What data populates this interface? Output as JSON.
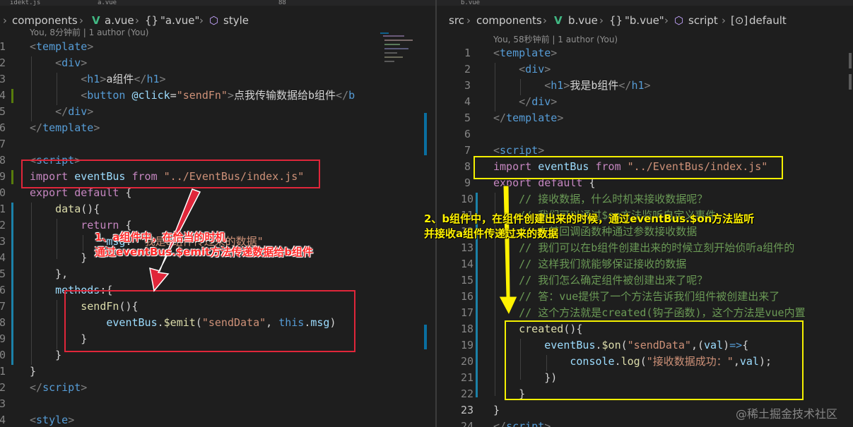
{
  "left": {
    "tab_fragments": [
      "idekt.js",
      "a.vue",
      "88"
    ],
    "breadcrumb": {
      "folder": "components",
      "file": "a.vue",
      "component": "\"a.vue\"",
      "section": "style"
    },
    "blame": "You, 8分钟前 | 1 author (You)",
    "line_numbers": [
      "1",
      "2",
      "3",
      "4",
      "5",
      "6",
      "7",
      "8",
      "9",
      "0",
      "1",
      "2",
      "3",
      "4",
      "5",
      "6",
      "7",
      "8",
      "9",
      "0",
      "1",
      "2",
      "3",
      "4",
      "5"
    ],
    "lines": [
      [
        [
          "punct",
          "<"
        ],
        [
          "tag",
          "template"
        ],
        [
          "punct",
          ">"
        ]
      ],
      [
        [
          "txt",
          "    "
        ],
        [
          "punct",
          "<"
        ],
        [
          "tag",
          "div"
        ],
        [
          "punct",
          ">"
        ]
      ],
      [
        [
          "txt",
          "        "
        ],
        [
          "punct",
          "<"
        ],
        [
          "tag",
          "h1"
        ],
        [
          "punct",
          ">"
        ],
        [
          "txt",
          "a组件"
        ],
        [
          "punct",
          "</"
        ],
        [
          "tag",
          "h1"
        ],
        [
          "punct",
          ">"
        ]
      ],
      [
        [
          "txt",
          "        "
        ],
        [
          "punct",
          "<"
        ],
        [
          "tag",
          "button"
        ],
        [
          "txt",
          " "
        ],
        [
          "attr",
          "@click"
        ],
        [
          "txt",
          "="
        ],
        [
          "str",
          "\"sendFn\""
        ],
        [
          "punct",
          ">"
        ],
        [
          "txt",
          "点我传输数据给b组件"
        ],
        [
          "punct",
          "</"
        ],
        [
          "tag",
          "b"
        ]
      ],
      [
        [
          "txt",
          "    "
        ],
        [
          "punct",
          "</"
        ],
        [
          "tag",
          "div"
        ],
        [
          "punct",
          ">"
        ]
      ],
      [
        [
          "punct",
          "</"
        ],
        [
          "tag",
          "template"
        ],
        [
          "punct",
          ">"
        ]
      ],
      [
        [
          "txt",
          ""
        ]
      ],
      [
        [
          "punct",
          "<"
        ],
        [
          "tag",
          "script"
        ],
        [
          "punct",
          ">"
        ]
      ],
      [
        [
          "kw",
          "import"
        ],
        [
          "txt",
          " "
        ],
        [
          "var",
          "eventBus"
        ],
        [
          "txt",
          " "
        ],
        [
          "kw",
          "from"
        ],
        [
          "txt",
          " "
        ],
        [
          "str",
          "\"../EventBus/index.js\""
        ]
      ],
      [
        [
          "kw",
          "export"
        ],
        [
          "txt",
          " "
        ],
        [
          "kw",
          "default"
        ],
        [
          "txt",
          " {"
        ]
      ],
      [
        [
          "txt",
          "    "
        ],
        [
          "fn",
          "data"
        ],
        [
          "txt",
          "(){"
        ]
      ],
      [
        [
          "txt",
          "        "
        ],
        [
          "kw",
          "return"
        ],
        [
          "txt",
          " {"
        ]
      ],
      [
        [
          "txt",
          "            "
        ],
        [
          "var",
          "msg"
        ],
        [
          "txt",
          ": "
        ],
        [
          "str",
          "\"我是a组件传过来的数据\""
        ]
      ],
      [
        [
          "txt",
          "        }"
        ]
      ],
      [
        [
          "txt",
          "    },"
        ]
      ],
      [
        [
          "txt",
          "    "
        ],
        [
          "var",
          "methods"
        ],
        [
          "txt",
          ":{"
        ]
      ],
      [
        [
          "txt",
          "        "
        ],
        [
          "fn",
          "sendFn"
        ],
        [
          "txt",
          "(){"
        ]
      ],
      [
        [
          "txt",
          "            "
        ],
        [
          "var",
          "eventBus"
        ],
        [
          "txt",
          "."
        ],
        [
          "fn",
          "$emit"
        ],
        [
          "txt",
          "("
        ],
        [
          "str",
          "\"sendData\""
        ],
        [
          "txt",
          ", "
        ],
        [
          "kwb",
          "this"
        ],
        [
          "txt",
          "."
        ],
        [
          "var",
          "msg"
        ],
        [
          "txt",
          ")"
        ]
      ],
      [
        [
          "txt",
          "        }"
        ]
      ],
      [
        [
          "txt",
          "    }"
        ]
      ],
      [
        [
          "txt",
          "}"
        ]
      ],
      [
        [
          "punct",
          "</"
        ],
        [
          "tag",
          "script"
        ],
        [
          "punct",
          ">"
        ]
      ],
      [
        [
          "txt",
          ""
        ]
      ],
      [
        [
          "punct",
          "<"
        ],
        [
          "tag",
          "style"
        ],
        [
          "punct",
          ">"
        ]
      ],
      [
        [
          "txt",
          ""
        ]
      ]
    ],
    "annotation": [
      "1、a组件中，在恰当的时机",
      "通过eventBus.$emit方法传递数据给b组件"
    ]
  },
  "right": {
    "tab_fragments": [
      "b.vue"
    ],
    "breadcrumb": {
      "root": "src",
      "folder": "components",
      "file": "b.vue",
      "component": "\"b.vue\"",
      "section": "script",
      "symbol": "default"
    },
    "blame": "You, 58秒钟前 | 1 author (You)",
    "line_numbers": [
      "1",
      "2",
      "3",
      "4",
      "5",
      "6",
      "7",
      "8",
      "9",
      "10",
      "11",
      "12",
      "13",
      "14",
      "15",
      "16",
      "17",
      "18",
      "19",
      "20",
      "21",
      "22",
      "23",
      "24"
    ],
    "active_line": "23",
    "lines": [
      [
        [
          "punct",
          "<"
        ],
        [
          "tag",
          "template"
        ],
        [
          "punct",
          ">"
        ]
      ],
      [
        [
          "txt",
          "    "
        ],
        [
          "punct",
          "<"
        ],
        [
          "tag",
          "div"
        ],
        [
          "punct",
          ">"
        ]
      ],
      [
        [
          "txt",
          "        "
        ],
        [
          "punct",
          "<"
        ],
        [
          "tag",
          "h1"
        ],
        [
          "punct",
          ">"
        ],
        [
          "txt",
          "我是b组件"
        ],
        [
          "punct",
          "</"
        ],
        [
          "tag",
          "h1"
        ],
        [
          "punct",
          ">"
        ]
      ],
      [
        [
          "txt",
          "    "
        ],
        [
          "punct",
          "</"
        ],
        [
          "tag",
          "div"
        ],
        [
          "punct",
          ">"
        ]
      ],
      [
        [
          "punct",
          "</"
        ],
        [
          "tag",
          "template"
        ],
        [
          "punct",
          ">"
        ]
      ],
      [
        [
          "txt",
          ""
        ]
      ],
      [
        [
          "punct",
          "<"
        ],
        [
          "tag",
          "script"
        ],
        [
          "punct",
          ">"
        ]
      ],
      [
        [
          "kw",
          "import"
        ],
        [
          "txt",
          " "
        ],
        [
          "var",
          "eventBus"
        ],
        [
          "txt",
          " "
        ],
        [
          "kw",
          "from"
        ],
        [
          "txt",
          " "
        ],
        [
          "str",
          "\"../EventBus/index.js\""
        ]
      ],
      [
        [
          "kw",
          "export"
        ],
        [
          "txt",
          " "
        ],
        [
          "kw",
          "default"
        ],
        [
          "txt",
          " {"
        ]
      ],
      [
        [
          "txt",
          "    "
        ],
        [
          "cmt",
          "// 接收数据，什么时机来接收数据呢？"
        ]
      ],
      [
        [
          "txt",
          "    "
        ],
        [
          "cmt",
          "// 我们可以通过$on方法监听自定义事件"
        ]
      ],
      [
        [
          "txt",
          "    "
        ],
        [
          "cmt",
          "// 在其回调函数种通过参数接收数据"
        ]
      ],
      [
        [
          "txt",
          "    "
        ],
        [
          "cmt",
          "// 我们可以在b组件创建出来的时候立刻开始侦听a组件的"
        ]
      ],
      [
        [
          "txt",
          "    "
        ],
        [
          "cmt",
          "// 这样我们就能够保证接收的数据"
        ]
      ],
      [
        [
          "txt",
          "    "
        ],
        [
          "cmt",
          "// 我们怎么确定组件被创建出来了呢？"
        ]
      ],
      [
        [
          "txt",
          "    "
        ],
        [
          "cmt",
          "// 答：vue提供了一个方法告诉我们组件被创建出来了"
        ]
      ],
      [
        [
          "txt",
          "    "
        ],
        [
          "cmt",
          "// 这个方法就是created(钩子函数)，这个方法是vue内置"
        ]
      ],
      [
        [
          "txt",
          "    "
        ],
        [
          "fn",
          "created"
        ],
        [
          "txt",
          "(){"
        ]
      ],
      [
        [
          "txt",
          "        "
        ],
        [
          "var",
          "eventBus"
        ],
        [
          "txt",
          "."
        ],
        [
          "fn",
          "$on"
        ],
        [
          "txt",
          "("
        ],
        [
          "str",
          "\"sendData\""
        ],
        [
          "txt",
          ",("
        ],
        [
          "var",
          "val"
        ],
        [
          "txt",
          ")"
        ],
        [
          "kwb",
          "=>"
        ],
        [
          "txt",
          "{"
        ]
      ],
      [
        [
          "txt",
          "            "
        ],
        [
          "var",
          "console"
        ],
        [
          "txt",
          "."
        ],
        [
          "fn",
          "log"
        ],
        [
          "txt",
          "("
        ],
        [
          "str",
          "\"接收数据成功：\""
        ],
        [
          "txt",
          ","
        ],
        [
          "var",
          "val"
        ],
        [
          "txt",
          ");"
        ]
      ],
      [
        [
          "txt",
          "        })"
        ]
      ],
      [
        [
          "txt",
          "    }"
        ]
      ],
      [
        [
          "txt",
          "}"
        ]
      ],
      [
        [
          "punct",
          "</"
        ],
        [
          "tag",
          "script"
        ],
        [
          "punct",
          ">"
        ]
      ]
    ],
    "annotation": [
      "2、b组件中，在组件创建出来的时候，通过eventBus.$on方法监听",
      "并接收a组件传递过来的数据"
    ]
  },
  "watermark": "@稀土掘金技术社区",
  "colors": {
    "annotation_red": "#e0263a",
    "annotation_yellow": "#f4f000",
    "editor_bg": "#1e1e1e"
  }
}
